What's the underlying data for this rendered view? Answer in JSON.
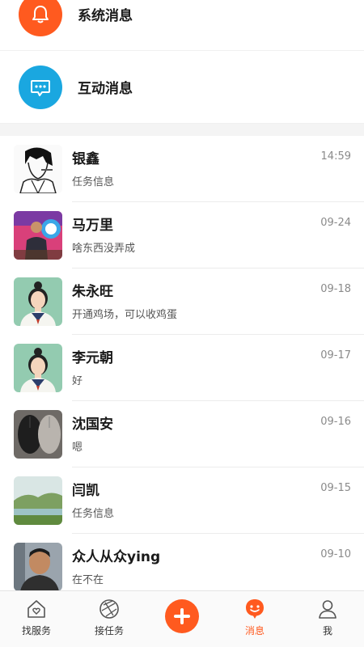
{
  "system_rows": [
    {
      "title": "系统消息",
      "icon": "bell-icon",
      "color": "#ff5a1f"
    },
    {
      "title": "互动消息",
      "icon": "chat-bubble-icon",
      "color": "#1aa7e0"
    }
  ],
  "chats": [
    {
      "name": "银鑫",
      "preview": "任务信息",
      "time": "14:59",
      "avatar": "manga-avatar"
    },
    {
      "name": "马万里",
      "preview": "啥东西没弄成",
      "time": "09-24",
      "avatar": "photo-avatar"
    },
    {
      "name": "朱永旺",
      "preview": "开通鸡场，可以收鸡蛋",
      "time": "09-18",
      "avatar": "default-girl-avatar"
    },
    {
      "name": "李元朝",
      "preview": "好",
      "time": "09-17",
      "avatar": "default-girl-avatar"
    },
    {
      "name": "沈国安",
      "preview": "嗯",
      "time": "09-16",
      "avatar": "mouse-photo-avatar"
    },
    {
      "name": "闫凯",
      "preview": "任务信息",
      "time": "09-15",
      "avatar": "landscape-avatar"
    },
    {
      "name": "众人从众ying",
      "preview": "在不在",
      "time": "09-10",
      "avatar": "man-photo-avatar"
    }
  ],
  "tabbar": {
    "tabs": [
      {
        "label": "找服务",
        "icon": "home-heart-icon"
      },
      {
        "label": "接任务",
        "icon": "aperture-icon"
      },
      {
        "label": "",
        "icon": "plus-icon"
      },
      {
        "label": "消息",
        "icon": "smile-bubble-icon",
        "active": true
      },
      {
        "label": "我",
        "icon": "person-icon"
      }
    ],
    "accent": "#ff5a1f"
  }
}
